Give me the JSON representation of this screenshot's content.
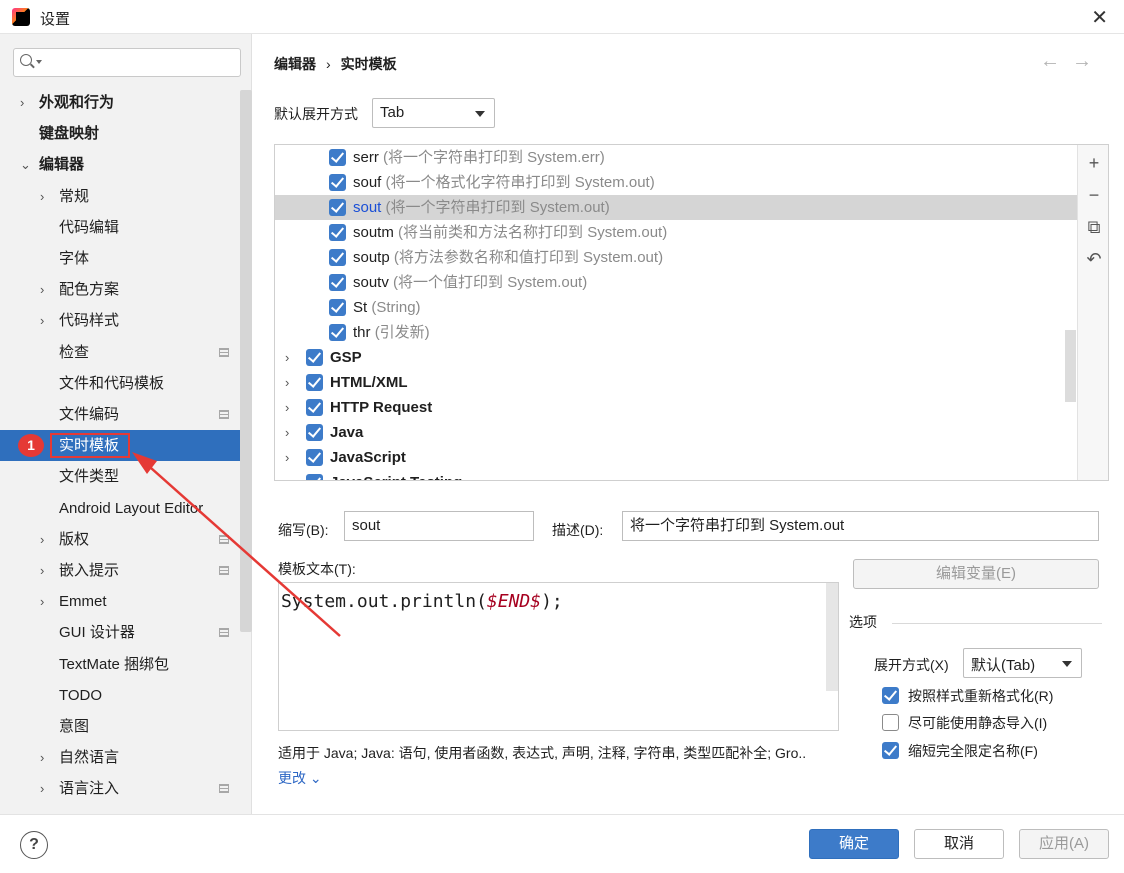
{
  "window": {
    "title": "设置"
  },
  "search": {
    "placeholder": "",
    "value": ""
  },
  "sidebar": {
    "items": [
      {
        "label": "外观和行为",
        "bold": true,
        "chevron": true,
        "level": 0
      },
      {
        "label": "键盘映射",
        "bold": true,
        "chevron": false,
        "level": 0
      },
      {
        "label": "编辑器",
        "bold": true,
        "chevron": true,
        "expanded": true,
        "level": 0
      },
      {
        "label": "常规",
        "chevron": true,
        "level": 1
      },
      {
        "label": "代码编辑",
        "level": 1
      },
      {
        "label": "字体",
        "level": 1
      },
      {
        "label": "配色方案",
        "chevron": true,
        "level": 1
      },
      {
        "label": "代码样式",
        "chevron": true,
        "level": 1
      },
      {
        "label": "检查",
        "level": 1,
        "mini": true
      },
      {
        "label": "文件和代码模板",
        "level": 1
      },
      {
        "label": "文件编码",
        "level": 1,
        "mini": true
      },
      {
        "label": "实时模板",
        "level": 1,
        "selected": true
      },
      {
        "label": "文件类型",
        "level": 1
      },
      {
        "label": "Android Layout Editor",
        "level": 1
      },
      {
        "label": "版权",
        "chevron": true,
        "level": 1,
        "mini": true
      },
      {
        "label": "嵌入提示",
        "chevron": true,
        "level": 1,
        "mini": true
      },
      {
        "label": "Emmet",
        "chevron": true,
        "level": 1
      },
      {
        "label": "GUI 设计器",
        "level": 1,
        "mini": true
      },
      {
        "label": "TextMate 捆绑包",
        "level": 1
      },
      {
        "label": "TODO",
        "level": 1
      },
      {
        "label": "意图",
        "level": 1
      },
      {
        "label": "自然语言",
        "chevron": true,
        "level": 1
      },
      {
        "label": "语言注入",
        "chevron": true,
        "level": 1,
        "mini": true
      }
    ]
  },
  "annotation": {
    "badge": "1"
  },
  "breadcrumb": {
    "parent": "编辑器",
    "separator": "›",
    "current": "实时模板"
  },
  "nav": {
    "back": "←",
    "forward": "→"
  },
  "expand": {
    "label": "默认展开方式",
    "value": "Tab"
  },
  "templates": [
    {
      "abbr": "serr",
      "desc": "(将一个字符串打印到 System.err)",
      "checked": true
    },
    {
      "abbr": "souf",
      "desc": "(将一个格式化字符串打印到 System.out)",
      "checked": true
    },
    {
      "abbr": "sout",
      "desc": "(将一个字符串打印到 System.out)",
      "checked": true,
      "selected": true
    },
    {
      "abbr": "soutm",
      "desc": "(将当前类和方法名称打印到 System.out)",
      "checked": true
    },
    {
      "abbr": "soutp",
      "desc": "(将方法参数名称和值打印到 System.out)",
      "checked": true
    },
    {
      "abbr": "soutv",
      "desc": "(将一个值打印到 System.out)",
      "checked": true
    },
    {
      "abbr": "St",
      "desc": "(String)",
      "checked": true
    },
    {
      "abbr": "thr",
      "desc": "(引发新)",
      "checked": true
    }
  ],
  "groups": [
    {
      "name": "GSP",
      "checked": true
    },
    {
      "name": "HTML/XML",
      "checked": true
    },
    {
      "name": "HTTP Request",
      "checked": true
    },
    {
      "name": "Java",
      "checked": true
    },
    {
      "name": "JavaScript",
      "checked": true
    },
    {
      "name": "JavaScript Testing",
      "checked": true
    }
  ],
  "toolbar": {
    "add": "+",
    "remove": "−",
    "copy": "⧉",
    "revert": "↶"
  },
  "form": {
    "abbr_label": "缩写(B):",
    "abbr_value": "sout",
    "desc_label": "描述(D):",
    "desc_value": "将一个字符串打印到 System.out",
    "template_label": "模板文本(T):",
    "code_prefix": "System.out.println(",
    "code_var": "$END$",
    "code_suffix": ");",
    "edit_vars": "编辑变量(E)",
    "context": "适用于 Java; Java: 语句, 使用者函数, 表达式, 声明, 注释, 字符串, 类型匹配补全; Gro..",
    "change": "更改 ⌄"
  },
  "options": {
    "title": "选项",
    "expand_label": "展开方式(X)",
    "expand_value": "默认(Tab)",
    "reformat": {
      "label": "按照样式重新格式化(R)",
      "checked": true
    },
    "static_import": {
      "label": "尽可能使用静态导入(I)",
      "checked": false
    },
    "shorten_fq": {
      "label": "缩短完全限定名称(F)",
      "checked": true
    }
  },
  "footer": {
    "help": "?",
    "ok": "确定",
    "cancel": "取消",
    "apply": "应用(A)"
  },
  "colors": {
    "selection": "#2f6fbd",
    "accent": "#3d7bc9",
    "annotation": "#e53935"
  }
}
